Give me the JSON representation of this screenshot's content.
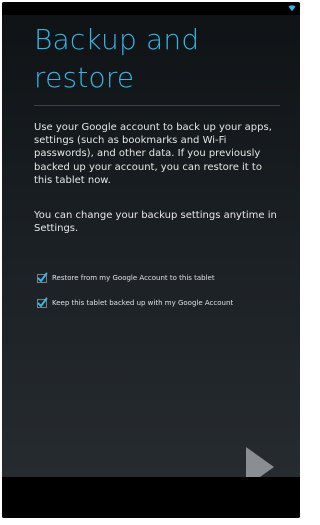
{
  "screen": {
    "title": "Backup and restore",
    "description": "Use your Google account to back up your apps, settings (such as bookmarks and Wi-Fi passwords), and other data. If you previously backed up your account, you can restore it to this tablet now.",
    "note": "You can change your backup settings anytime in Settings."
  },
  "options": [
    {
      "label": "Restore from my Google Account to this tablet",
      "checked": true
    },
    {
      "label": "Keep this tablet backed up with my Google Account",
      "checked": true
    }
  ],
  "icons": {
    "status": "wifi-icon",
    "checkbox": "checkmark-icon",
    "next": "next-arrow-icon"
  },
  "colors": {
    "accent": "#33b5e5",
    "text": "#e7e7e7",
    "next_arrow": "#8a8d91"
  }
}
